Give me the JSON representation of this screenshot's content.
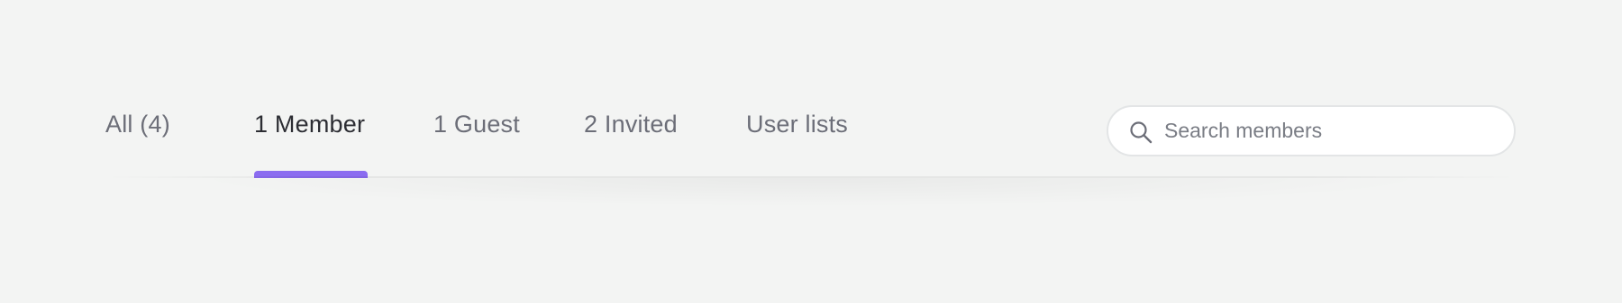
{
  "tabs": [
    {
      "label": "All (4)",
      "active": false
    },
    {
      "label": "1 Member",
      "active": true
    },
    {
      "label": "1 Guest",
      "active": false
    },
    {
      "label": "2 Invited",
      "active": false
    },
    {
      "label": "User lists",
      "active": false
    }
  ],
  "search": {
    "placeholder": "Search members",
    "value": "",
    "icon": "search-icon"
  },
  "colors": {
    "background": "#f3f4f3",
    "active_tab_text": "#2c2d33",
    "inactive_tab_text": "#6c6e78",
    "accent_indicator": "#8b6cf0",
    "search_border": "#e3e5e6"
  }
}
